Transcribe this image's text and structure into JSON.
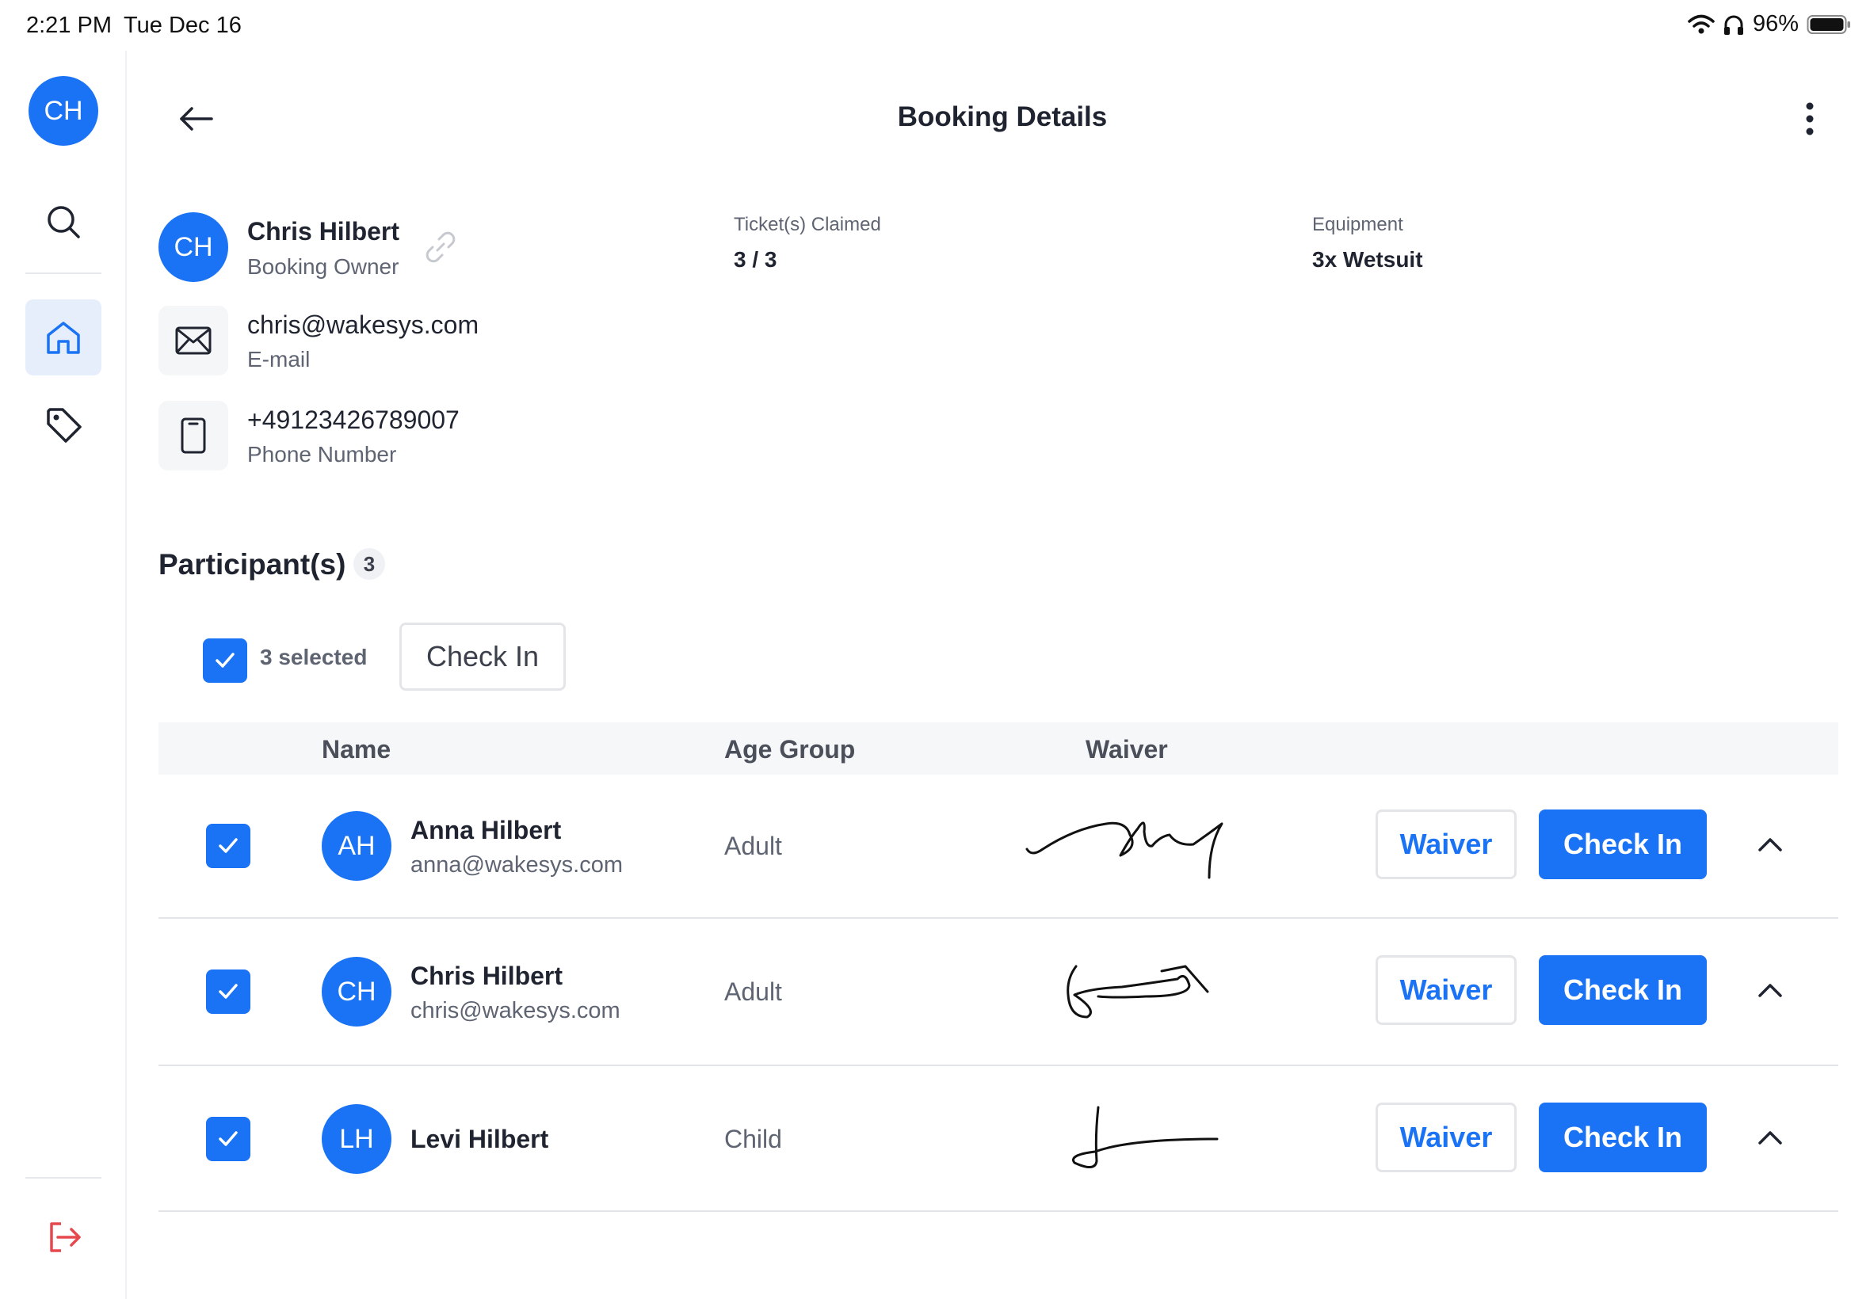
{
  "status_bar": {
    "time": "2:21 PM",
    "date": "Tue Dec 16",
    "battery": "96%"
  },
  "sidebar": {
    "avatar_initials": "CH",
    "items": [
      {
        "name": "search",
        "icon": "search-icon"
      },
      {
        "name": "home",
        "icon": "home-icon",
        "active": true
      },
      {
        "name": "tags",
        "icon": "tag-icon"
      },
      {
        "name": "logout",
        "icon": "logout-icon"
      }
    ]
  },
  "header": {
    "title": "Booking Details"
  },
  "owner": {
    "initials": "CH",
    "name": "Chris Hilbert",
    "role": "Booking Owner",
    "email": "chris@wakesys.com",
    "email_label": "E-mail",
    "phone": "+49123426789007",
    "phone_label": "Phone Number"
  },
  "stats": {
    "tickets_label": "Ticket(s) Claimed",
    "tickets_value": "3 / 3",
    "equipment_label": "Equipment",
    "equipment_value": "3x Wetsuit"
  },
  "participants": {
    "title": "Participant(s)",
    "count": "3",
    "selected_text": "3 selected",
    "bulk_checkin_label": "Check In",
    "columns": {
      "name": "Name",
      "age_group": "Age Group",
      "waiver": "Waiver"
    },
    "rows": [
      {
        "initials": "AH",
        "name": "Anna Hilbert",
        "email": "anna@wakesys.com",
        "age_group": "Adult",
        "waiver_label": "Waiver",
        "checkin_label": "Check In",
        "checked": true
      },
      {
        "initials": "CH",
        "name": "Chris Hilbert",
        "email": "chris@wakesys.com",
        "age_group": "Adult",
        "waiver_label": "Waiver",
        "checkin_label": "Check In",
        "checked": true
      },
      {
        "initials": "LH",
        "name": "Levi Hilbert",
        "email": "",
        "age_group": "Child",
        "waiver_label": "Waiver",
        "checkin_label": "Check In",
        "checked": true
      }
    ]
  },
  "colors": {
    "accent": "#1a73f5",
    "logout": "#e5484d",
    "text": "#1f2430",
    "muted": "#5e6472"
  }
}
